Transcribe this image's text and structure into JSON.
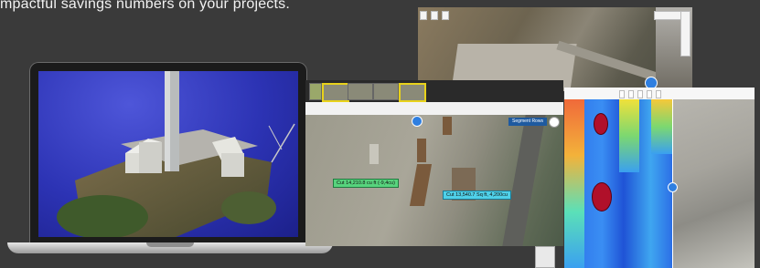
{
  "tagline": "mpactful savings numbers on your projects.",
  "colors": {
    "background": "#3a3a3a",
    "label_green": "#57d47d",
    "label_cyan": "#4fd0e8",
    "marker_blue": "#2f7fe0",
    "heat_red": "#b0102a"
  },
  "top_screenshot": {
    "buttons": [
      "",
      "",
      ""
    ]
  },
  "middle_screenshot": {
    "dropdown": "Segment Rows",
    "labels": [
      "Cut 14,210.8 cu ft (-9,4cu)",
      "Cut 13,540.7 Sq ft, 4,200cu"
    ]
  },
  "right_screenshot": {
    "toolbar_buttons": [
      "",
      "",
      "",
      "",
      ""
    ]
  },
  "icons": [
    "laptop-icon",
    "map-pin-icon",
    "zoom-controls-icon",
    "nav-arrows-icon"
  ]
}
